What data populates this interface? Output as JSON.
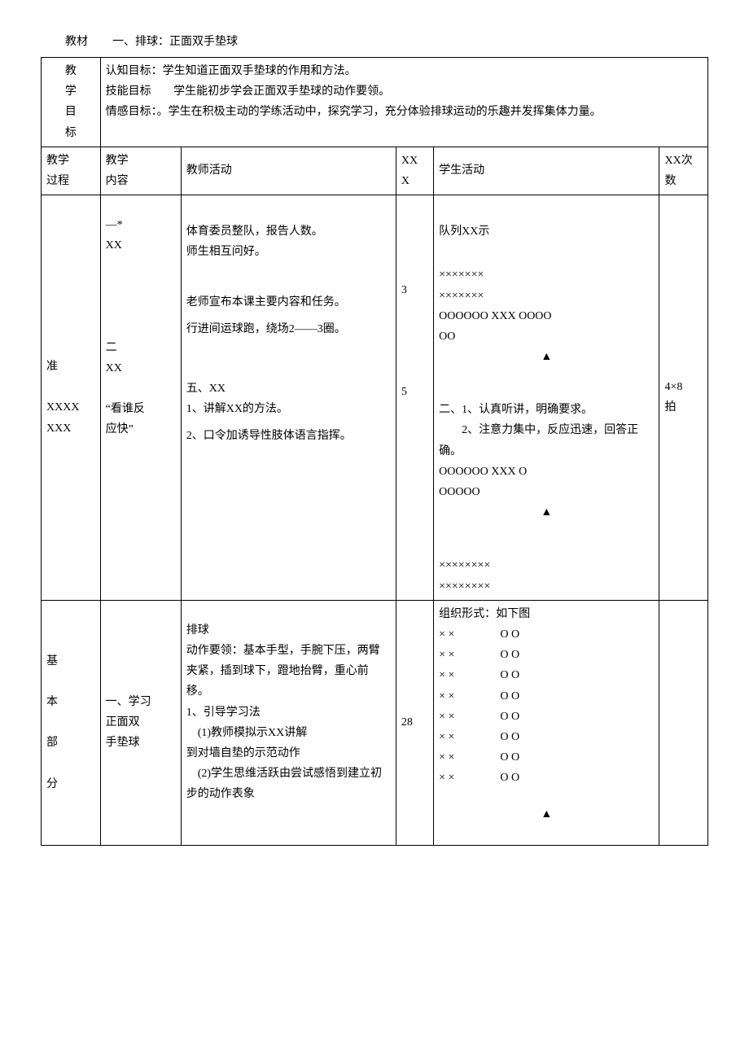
{
  "header": {
    "material_label": "教材",
    "material_text": "一、排球：正面双手垫球"
  },
  "goals": {
    "label": "教\n学\n目\n标",
    "line1": "认知目标：学生知道正面双手垫球的作用和方法。",
    "line2a": "技能目标",
    "line2b": "学生能初步学会正面双手垫球的动作要领。",
    "line3": "情感目标：。学生在积极主动的学练活动中，探究学习，充分体验排球运动的乐趣并发挥集体力量。"
  },
  "th": {
    "process": "教学\n过程",
    "content": "教学\n内容",
    "teacher": "教师活动",
    "time": "XX\nX",
    "student": "学生活动",
    "count": "XX次\n数"
  },
  "prep": {
    "process": "准\n\nXXXX\nXXX",
    "content1": "—*\nXX",
    "teacher1a": "体育委员整队，报告人数。\n师生相互问好。",
    "teacher1b": "老师宣布本课主要内容和任务。",
    "teacher1c": "行进间运球跑，绕场2——3圈。",
    "time1": "3",
    "student1a": "队列XX示",
    "student1b": "×××××××\n×××××××",
    "student1c": "OOOOOO XXX OOOO\nOO",
    "tri": "▲",
    "content2": "二\nXX\n\n“看谁反\n应快”",
    "teacher2a": "五、XX",
    "teacher2b": "1、讲解XX的方法。",
    "teacher2c": "2、口令加诱导性肢体语言指挥。",
    "time2": "5",
    "student2a": "二、1、认真听讲，明确要求。",
    "student2b": "　　2、注意力集中，反应迅速，回答正确。",
    "student2c": "OOOOOO XXX O\nOOOOO",
    "student2d": "××××××××\n××××××××",
    "count2": "4×8\n拍"
  },
  "basic": {
    "process": "基\n\n本\n\n部\n\n分",
    "content": "一、学习\n正面双\n手垫球",
    "teacher_a": "排球",
    "teacher_b": "动作要领：基本手型，手腕下压，两臂夹紧，插到球下，蹬地抬臂，重心前移。",
    "teacher_c": "1、引导学习法",
    "teacher_d": "　(1)教师模拟示XX讲解",
    "teacher_e": "到对墙自垫的示范动作",
    "teacher_f": "　(2)学生思维活跃由尝试感悟到建立初步的动作表象",
    "time": "28",
    "student_head": "组织形式：如下图",
    "row1": "× ×　　　　O O",
    "row2": "× ×　　　　O O",
    "row3": "× ×　　　　O O",
    "row4": "× ×　　　　O O",
    "row5": "× ×　　　　O O",
    "row6": "× ×　　　　O O",
    "row7": "× ×　　　　O O",
    "row8": "× ×　　　　O O",
    "tri": "▲"
  }
}
